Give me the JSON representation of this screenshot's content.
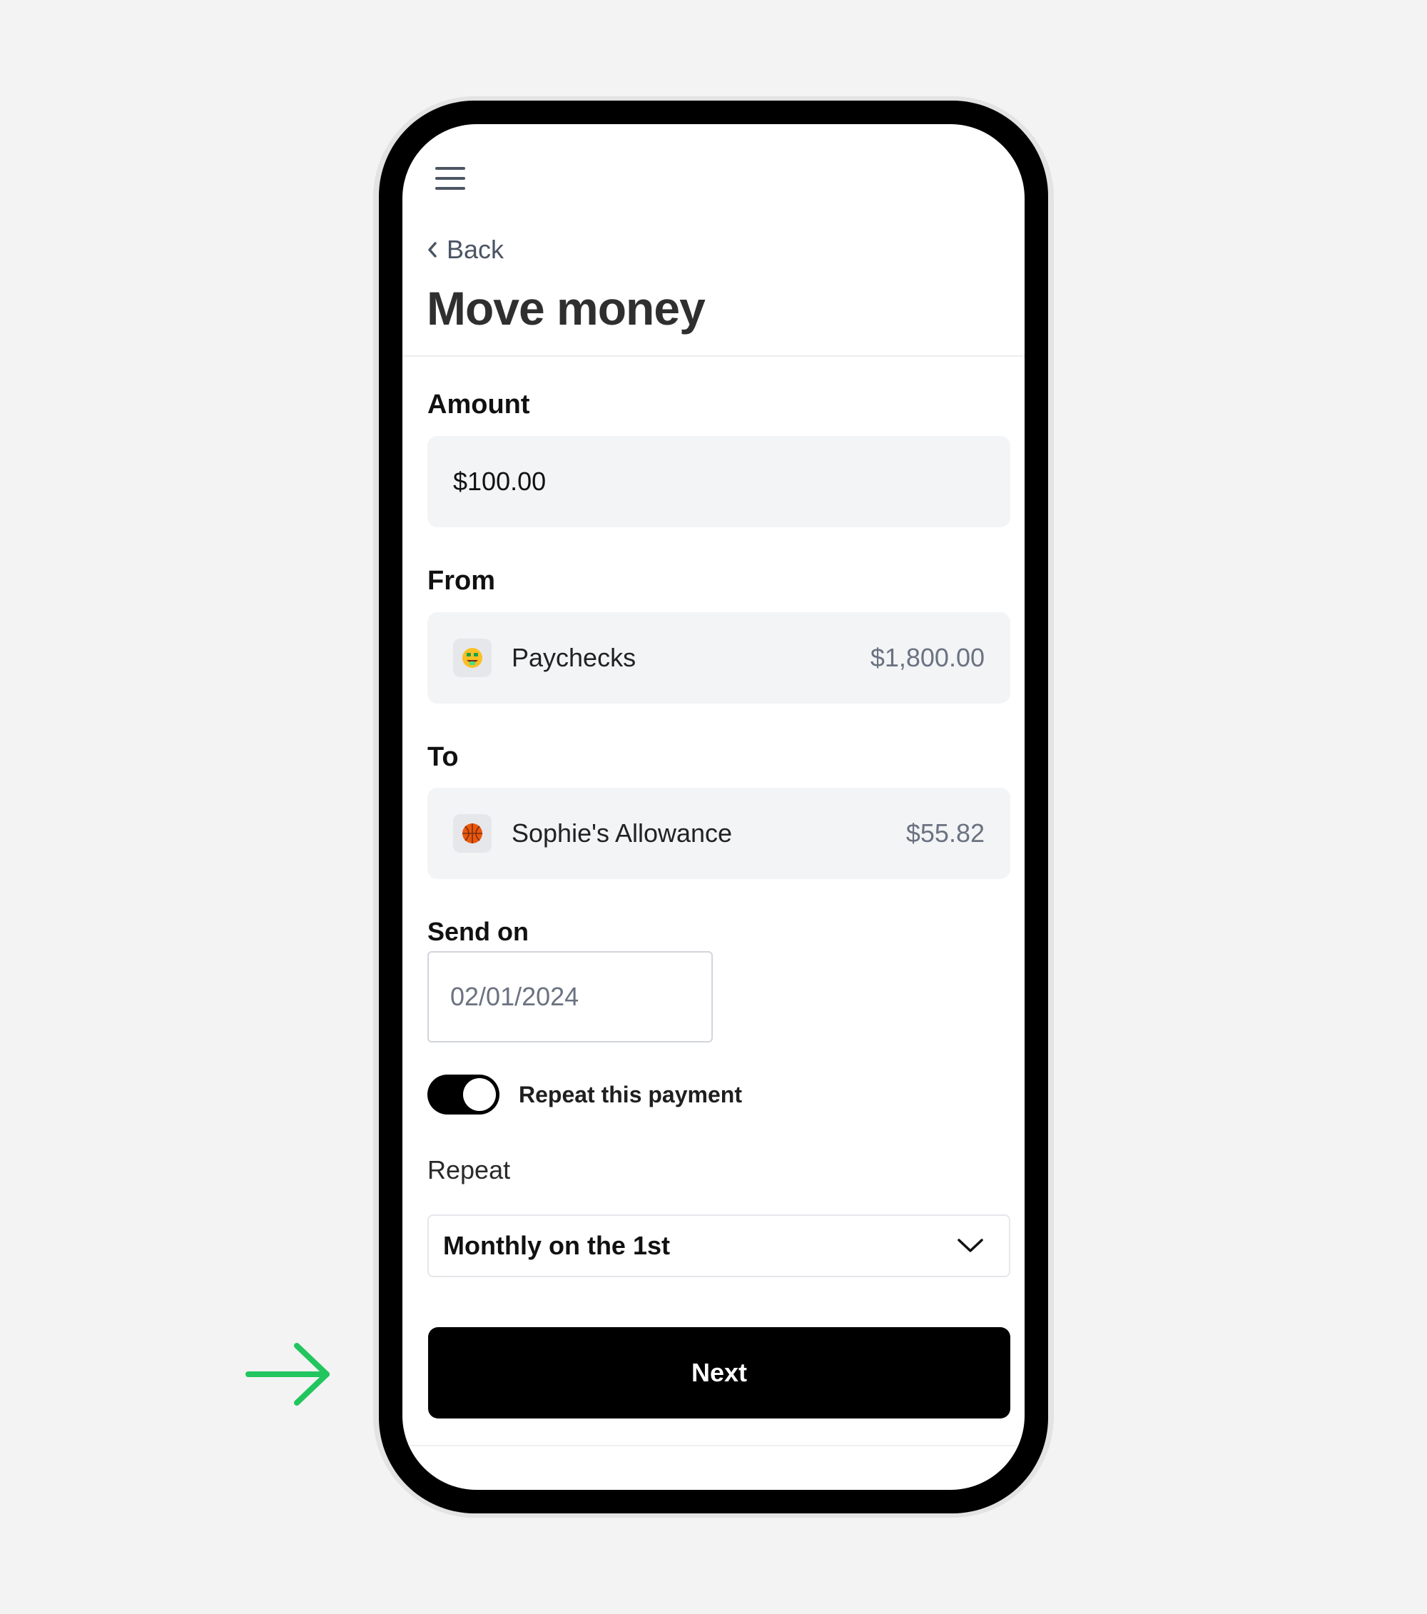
{
  "header": {
    "back_label": "Back",
    "title": "Move money"
  },
  "amount": {
    "label": "Amount",
    "value": "$100.00"
  },
  "from": {
    "label": "From",
    "emoji": "🤑",
    "account_name": "Paychecks",
    "balance": "$1,800.00"
  },
  "to": {
    "label": "To",
    "emoji": "🏀",
    "account_name": "Sophie's Allowance",
    "balance": "$55.82"
  },
  "send_on": {
    "label": "Send on",
    "value": "02/01/2024"
  },
  "repeat_toggle": {
    "label": "Repeat this payment",
    "enabled": true
  },
  "repeat": {
    "label": "Repeat",
    "selected": "Monthly on the 1st"
  },
  "actions": {
    "next_label": "Next"
  },
  "colors": {
    "pointer_arrow": "#22c55e",
    "primary_button": "#000000"
  }
}
